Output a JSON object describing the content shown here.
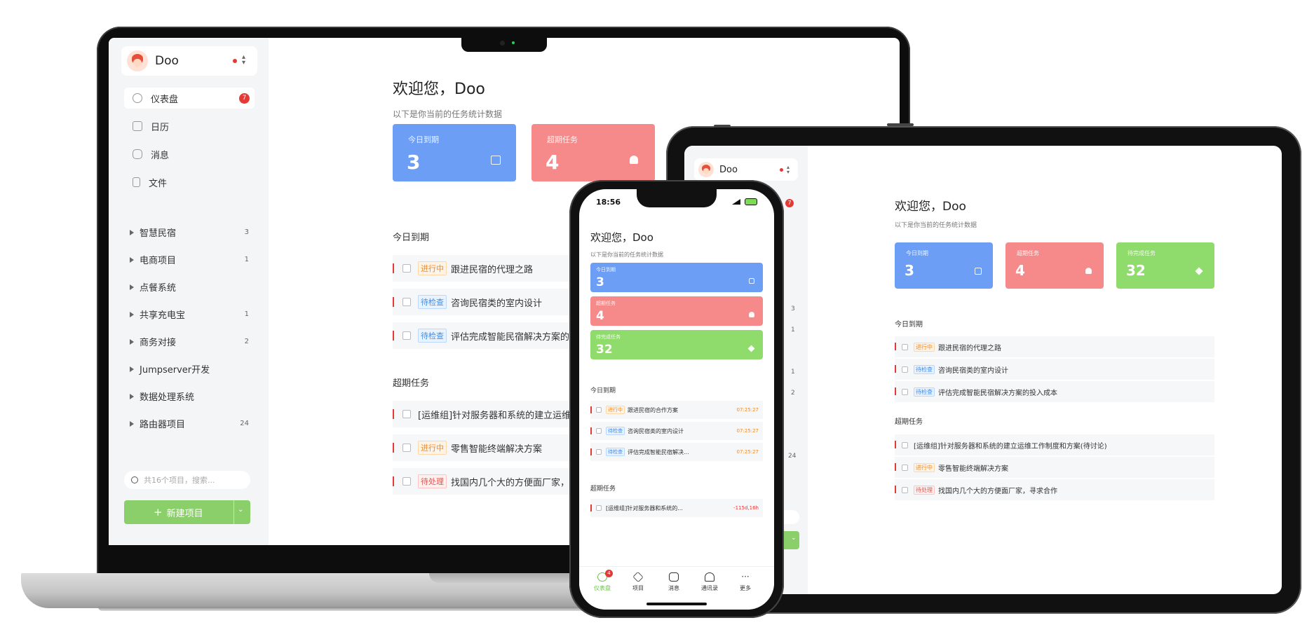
{
  "user": {
    "name": "Doo"
  },
  "nav": {
    "items": [
      {
        "label": "仪表盘",
        "badge": "7",
        "icon": "dashboard-icon"
      },
      {
        "label": "日历",
        "icon": "calendar-icon"
      },
      {
        "label": "消息",
        "icon": "message-icon"
      },
      {
        "label": "文件",
        "icon": "file-icon"
      }
    ]
  },
  "projects": [
    {
      "name": "智慧民宿",
      "count": "3"
    },
    {
      "name": "电商项目",
      "count": "1"
    },
    {
      "name": "点餐系统",
      "count": ""
    },
    {
      "name": "共享充电宝",
      "count": "1"
    },
    {
      "name": "商务对接",
      "count": "2"
    },
    {
      "name": "Jumpserver开发",
      "count": ""
    },
    {
      "name": "数据处理系统",
      "count": ""
    },
    {
      "name": "路由器项目",
      "count": "24"
    }
  ],
  "tablet_counts": [
    "3",
    "1",
    "",
    "1",
    "2",
    "",
    "",
    "24"
  ],
  "search": {
    "placeholder": "共16个项目，搜索..."
  },
  "new_project": {
    "label": "新建项目"
  },
  "dashboard": {
    "welcome": "欢迎您，Doo",
    "subtitle": "以下是你当前的任务统计数据",
    "cards": [
      {
        "label": "今日到期",
        "value": "3"
      },
      {
        "label": "超期任务",
        "value": "4"
      },
      {
        "label": "待完成任务",
        "value": "32"
      }
    ],
    "today_title": "今日到期",
    "overdue_title": "超期任务",
    "today_tasks": [
      {
        "tag": "进行中",
        "title": "跟进民宿的代理之路",
        "mobile_title": "跟进民宿的合作方案",
        "time": "07:25:27"
      },
      {
        "tag": "待检查",
        "title": "咨询民宿类的室内设计",
        "mobile_title": "咨询民宿类的室内设计",
        "time": "07:25:27"
      },
      {
        "tag": "待检查",
        "title": "评估完成智能民宿解决方案的投",
        "tablet_title": "评估完成智能民宿解决方案的投入成本",
        "mobile_title": "评估完成智能民宿解决...",
        "time": "07:25:27"
      }
    ],
    "overdue_tasks": [
      {
        "tag": "",
        "title": "[运维组]针对服务器和系统的建立运维工",
        "tablet_title": "[运维组]针对服务器和系统的建立运维工作制度和方案(待讨论)",
        "mobile_title": "[运维组]针对服务器和系统的...",
        "time": "-115d,16h"
      },
      {
        "tag": "进行中",
        "title": "零售智能终端解决方案",
        "tablet_title": "零售智能终端解决方案"
      },
      {
        "tag": "待处理",
        "title": "找国内几个大的方便面厂家，寻",
        "tablet_title": "找国内几个大的方便面厂家，寻求合作"
      }
    ]
  },
  "phone": {
    "time": "18:56",
    "tabs": [
      {
        "label": "仪表盘",
        "badge": "4",
        "icon": "dashboard-icon"
      },
      {
        "label": "项目",
        "icon": "layers-icon"
      },
      {
        "label": "消息",
        "icon": "message-icon"
      },
      {
        "label": "通讯录",
        "icon": "contacts-icon"
      },
      {
        "label": "更多",
        "icon": "more-icon"
      }
    ]
  },
  "colors": {
    "blue": "#6c9ef5",
    "red": "#f68a8a",
    "green": "#8fdb6b",
    "accent": "#8bcf6b",
    "badge": "#e53935"
  }
}
